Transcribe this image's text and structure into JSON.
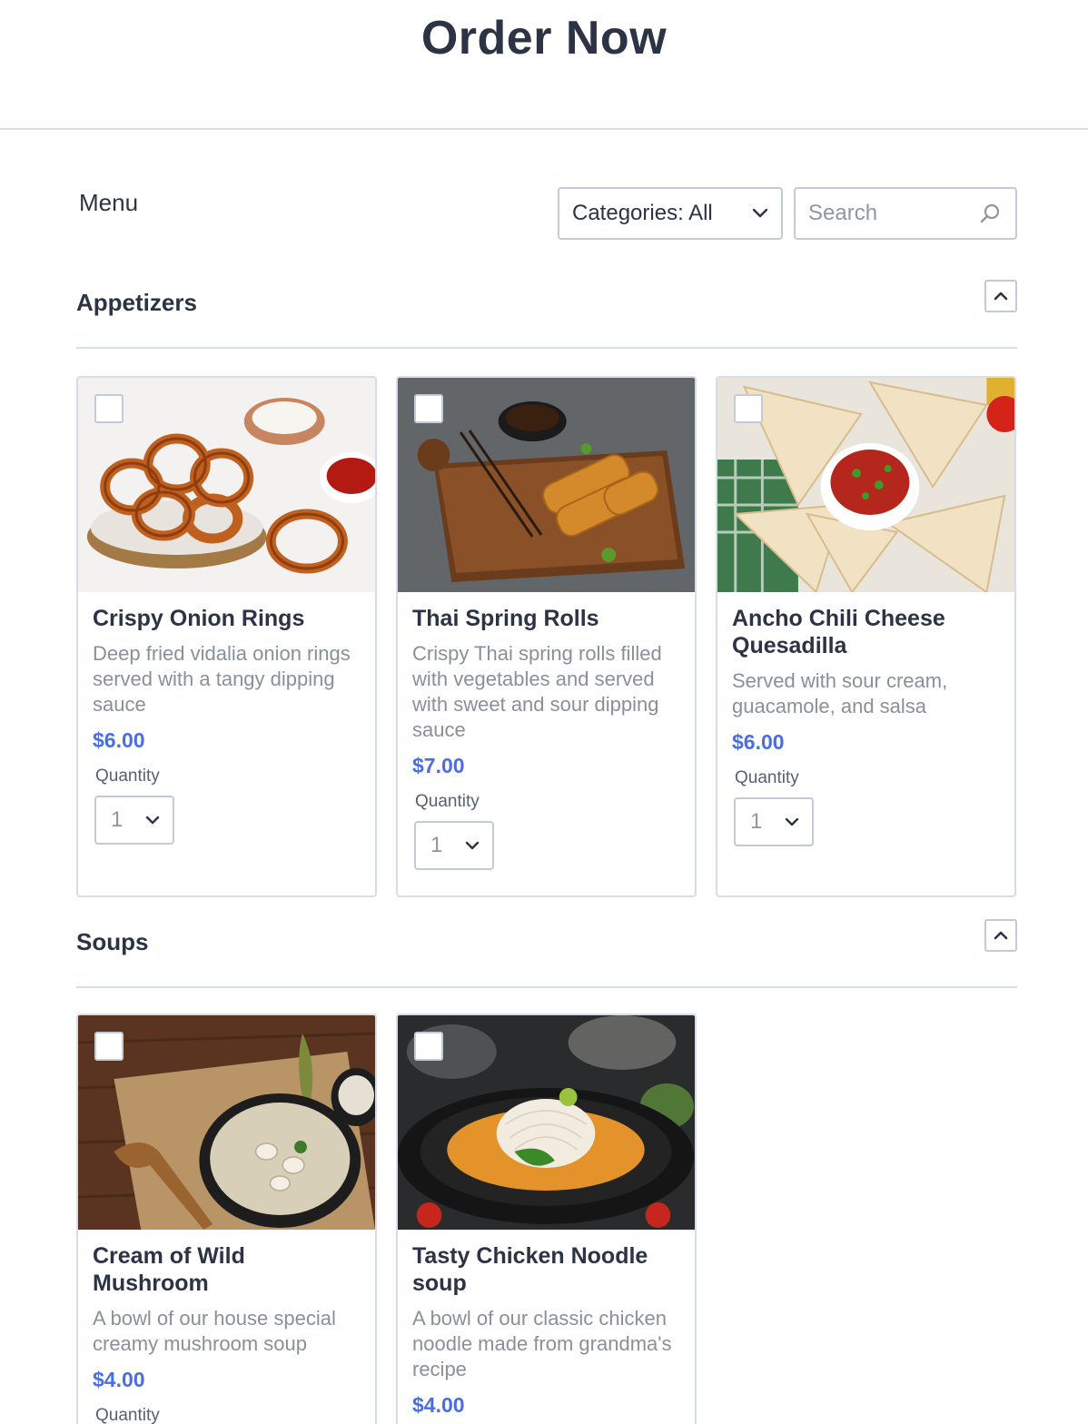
{
  "header": {
    "title": "Order Now"
  },
  "toolbar": {
    "menu_label": "Menu",
    "category_select": "Categories: All",
    "search_placeholder": "Search"
  },
  "sections": [
    {
      "title": "Appetizers",
      "items": [
        {
          "name": "Crispy Onion Rings",
          "description": "Deep fried vidalia onion rings served with a tangy dipping sauce",
          "price": "$6.00",
          "quantity_label": "Quantity",
          "quantity": "1"
        },
        {
          "name": "Thai Spring Rolls",
          "description": "Crispy Thai spring rolls filled with vegetables and served with sweet and sour dipping sauce",
          "price": "$7.00",
          "quantity_label": "Quantity",
          "quantity": "1"
        },
        {
          "name": "Ancho Chili Cheese Quesadilla",
          "description": "Served with sour cream, guacamole, and salsa",
          "price": "$6.00",
          "quantity_label": "Quantity",
          "quantity": "1"
        }
      ]
    },
    {
      "title": "Soups",
      "items": [
        {
          "name": "Cream of Wild Mushroom",
          "description": "A bowl of our house special creamy mushroom soup",
          "price": "$4.00",
          "quantity_label": "Quantity"
        },
        {
          "name": "Tasty Chicken Noodle soup",
          "description": "A bowl of our classic chicken noodle made from grandma's recipe",
          "price": "$4.00"
        }
      ]
    }
  ],
  "colors": {
    "price": "#4a6ee0",
    "border": "#c3cad8",
    "text": "#2c3345"
  }
}
